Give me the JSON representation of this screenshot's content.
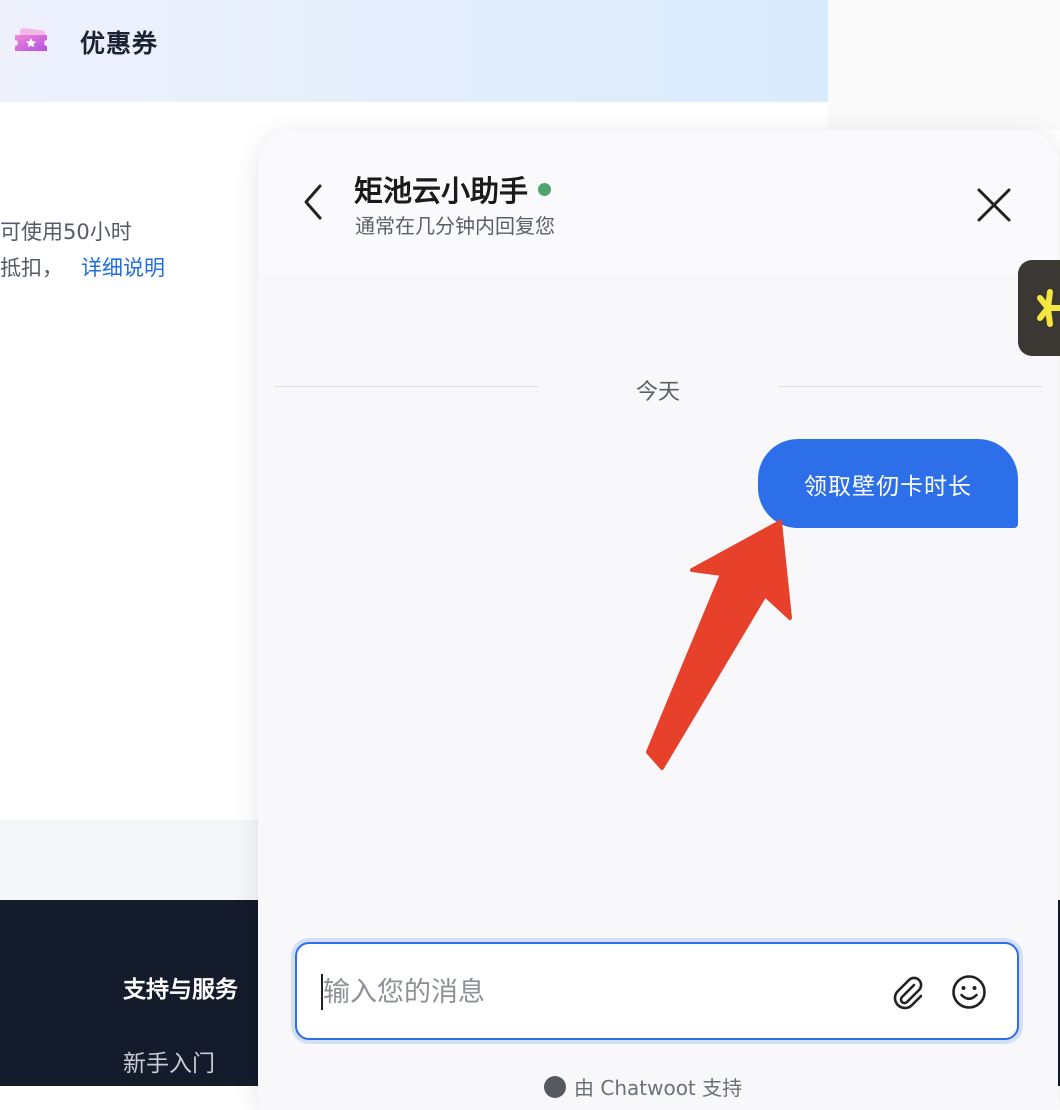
{
  "background": {
    "coupon_title": "优惠券",
    "line1": "可使用50小时",
    "line2": "抵扣，",
    "detail_link": "详细说明",
    "footer_heading": "支持与服务",
    "footer_link": "新手入门"
  },
  "chat": {
    "title": "矩池云小助手",
    "subtitle": "通常在几分钟内回复您",
    "date_divider": "今天",
    "messages": [
      {
        "text": "领取壁仞卡时长",
        "from": "user"
      }
    ],
    "input_placeholder": "输入您的消息",
    "powered_by": "由 Chatwoot 支持"
  },
  "colors": {
    "accent": "#2d6fe8",
    "online": "#4fa36c",
    "arrow": "#e8412b",
    "footer": "#141b2b"
  },
  "icons": {
    "back": "chevron-left-icon",
    "close": "close-icon",
    "attach": "paperclip-icon",
    "emoji": "smiley-icon",
    "coupon": "ticket-icon"
  }
}
